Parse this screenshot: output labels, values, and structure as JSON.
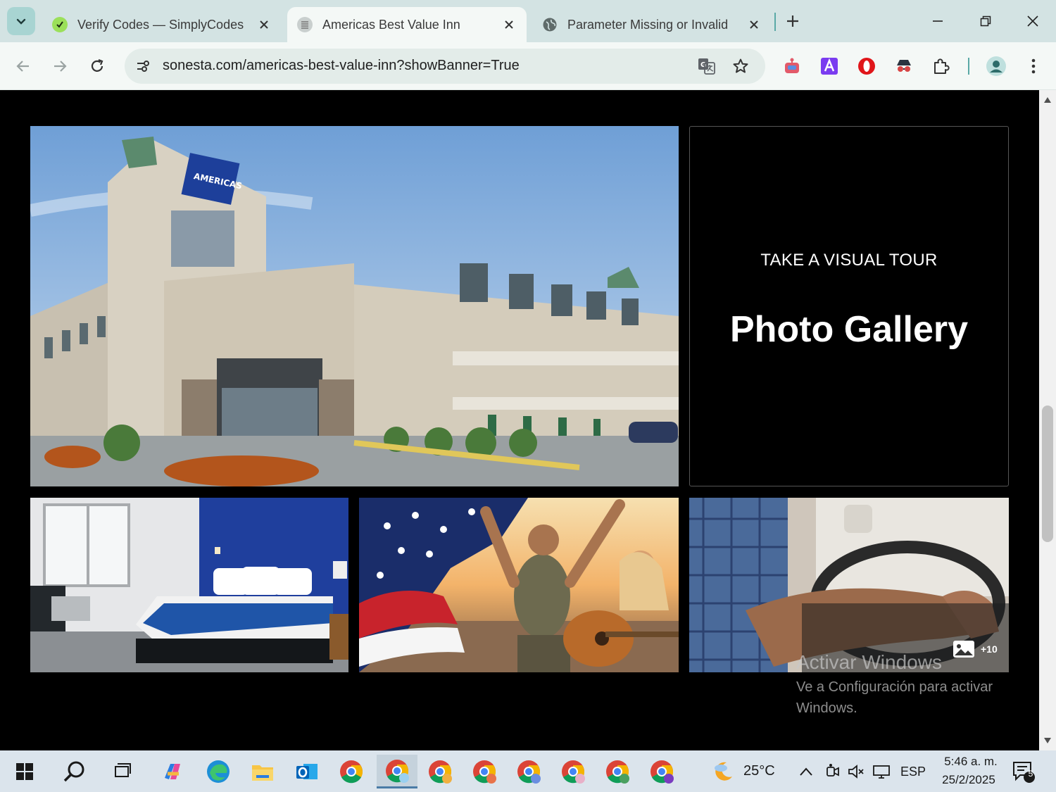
{
  "browser": {
    "tabs": [
      {
        "title": "Verify Codes — SimplyCodes",
        "active": false,
        "favicon": "simplycodes-icon"
      },
      {
        "title": "Americas Best Value Inn",
        "active": true,
        "favicon": "sonesta-icon"
      },
      {
        "title": "Parameter Missing or Invalid",
        "active": false,
        "favicon": "globe-icon"
      }
    ],
    "url": "sonesta.com/americas-best-value-inn?showBanner=True"
  },
  "page": {
    "gallery": {
      "kicker": "TAKE A VISUAL TOUR",
      "title": "Photo Gallery",
      "more_count": "+10",
      "images": [
        {
          "name": "hotel-exterior-image",
          "subject": "hotel exterior",
          "sign_text": "AMERICAS"
        },
        {
          "name": "hotel-room-image",
          "subject": "guest room"
        },
        {
          "name": "beach-flag-image",
          "subject": "people with american flag on beach"
        },
        {
          "name": "truck-driver-image",
          "subject": "driver steering wheel"
        }
      ]
    }
  },
  "watermark": {
    "line1": "Activar Windows",
    "line2": "Ve a Configuración para activar Windows."
  },
  "taskbar": {
    "temperature": "25°C",
    "language": "ESP",
    "time": "5:46 a. m.",
    "date": "25/2/2025",
    "notifications": "5"
  },
  "colors": {
    "tabstrip": "#d3e3e3",
    "toolbar": "#f4f8f6",
    "accent": "#5aa9a6",
    "page_bg": "#000000"
  }
}
